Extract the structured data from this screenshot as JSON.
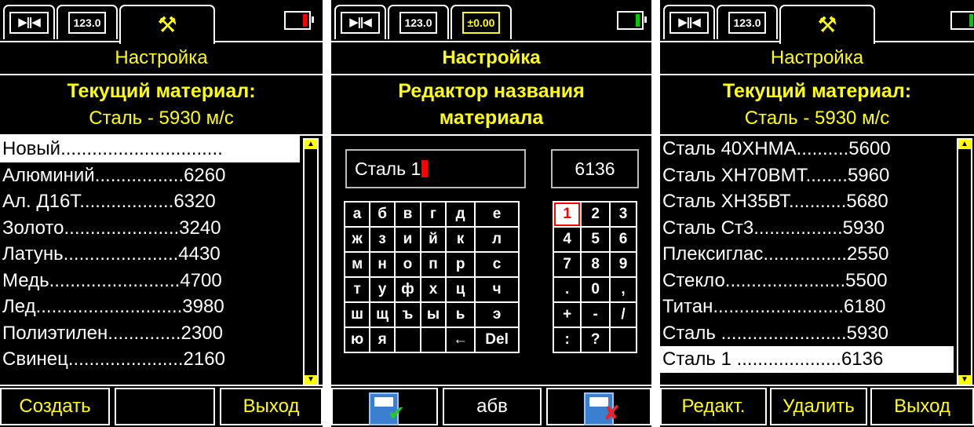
{
  "screens": [
    {
      "tabs": {
        "tab1_icon": "▶||◀",
        "tab2_icon": "123.0",
        "tab3_icon": "wrench-icon"
      },
      "battery_color": "#ff0000",
      "title": "Настройка",
      "header_line1": "Текущий материал:",
      "header_line2": "Сталь  - 5930 м/с",
      "items": [
        "Новый...............................",
        "Алюминий.................6260",
        "Ал. Д16Т..................6320",
        "Золото......................3240",
        "Латунь......................4430",
        "Медь.........................4700",
        "Лед............................3980",
        "Полиэтилен..............2300",
        "Свинец......................2160"
      ],
      "buttons": [
        "Создать",
        "",
        "Выход"
      ]
    },
    {
      "tabs": {
        "tab1_icon": "▶||◀",
        "tab2_icon": "123.0",
        "tab3_icon": "±0.00"
      },
      "battery_color": "#00cc00",
      "title": "Настройка",
      "header_line1": "Редактор названия",
      "header_line2": "материала",
      "name_value": "Сталь 1",
      "speed_value": "6136",
      "letters": [
        [
          "а",
          "б",
          "в",
          "г",
          "д",
          "е"
        ],
        [
          "ж",
          "з",
          "и",
          "й",
          "к",
          "л"
        ],
        [
          "м",
          "н",
          "о",
          "п",
          "р",
          "с"
        ],
        [
          "т",
          "у",
          "ф",
          "х",
          "ц",
          "ч"
        ],
        [
          "ш",
          "щ",
          "ъ",
          "ы",
          "ь",
          "э"
        ],
        [
          "ю",
          "я",
          "",
          "",
          "←",
          "Del"
        ]
      ],
      "digits": [
        [
          "1",
          "2",
          "3"
        ],
        [
          "4",
          "5",
          "6"
        ],
        [
          "7",
          "8",
          "9"
        ],
        [
          ".",
          "0",
          ","
        ],
        [
          "+",
          "-",
          "/"
        ],
        [
          ":",
          "?",
          ""
        ]
      ],
      "buttons": [
        "save-confirm-icon",
        "абв",
        "save-cancel-icon"
      ]
    },
    {
      "tabs": {
        "tab1_icon": "▶||◀",
        "tab2_icon": "123.0",
        "tab3_icon": "wrench-icon"
      },
      "battery_color": "#00cc00",
      "title": "Настройка",
      "header_line1": "Текущий материал:",
      "header_line2": "Сталь  - 5930 м/с",
      "items": [
        "Сталь 40ХНМА..........5600",
        "Сталь ХН70ВМТ........5960",
        "Сталь ХН35ВТ...........5680",
        "Сталь Ст3.................5930",
        "Плексиглас................2550",
        "Стекло.......................5500",
        "Титан.........................6180",
        "Сталь ........................5930",
        "Сталь 1 ....................6136"
      ],
      "buttons": [
        "Редакт.",
        "Удалить",
        "Выход"
      ]
    }
  ]
}
